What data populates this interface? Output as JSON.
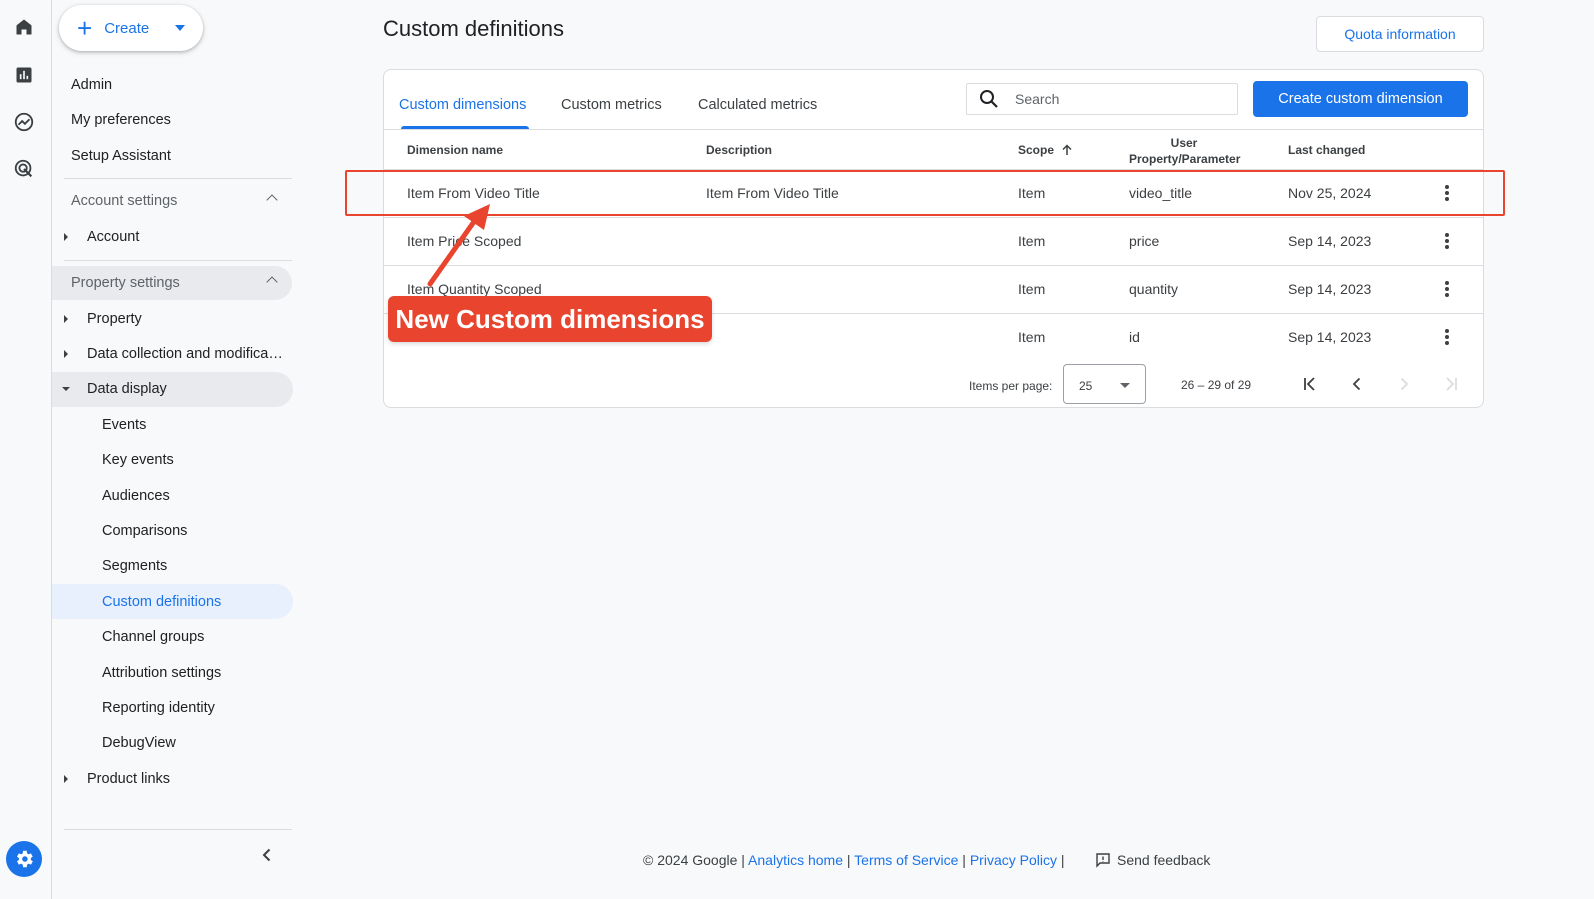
{
  "sidebar": {
    "create_label": "Create",
    "top_items": [
      "Admin",
      "My preferences",
      "Setup Assistant"
    ],
    "account_settings": {
      "header": "Account settings",
      "items": [
        "Account"
      ]
    },
    "property_settings": {
      "header": "Property settings",
      "items": [
        "Property",
        "Data collection and modifica…",
        "Data display"
      ],
      "data_display_children": [
        "Events",
        "Key events",
        "Audiences",
        "Comparisons",
        "Segments",
        "Custom definitions",
        "Channel groups",
        "Attribution settings",
        "Reporting identity",
        "DebugView"
      ],
      "product_links": "Product links"
    }
  },
  "main": {
    "title": "Custom definitions",
    "quota_button": "Quota information",
    "tabs": [
      "Custom dimensions",
      "Custom metrics",
      "Calculated metrics"
    ],
    "search_placeholder": "Search",
    "create_button": "Create custom dimension",
    "columns": {
      "name": "Dimension name",
      "description": "Description",
      "scope": "Scope",
      "user_property": "User Property/Parameter",
      "last_changed": "Last changed"
    },
    "rows": [
      {
        "name": "Item From Video Title",
        "description": "Item From Video Title",
        "scope": "Item",
        "param": "video_title",
        "date": "Nov 25, 2024"
      },
      {
        "name": "Item Price Scoped",
        "description": "",
        "scope": "Item",
        "param": "price",
        "date": "Sep 14, 2023"
      },
      {
        "name": "Item Quantity Scoped",
        "description": "",
        "scope": "Item",
        "param": "quantity",
        "date": "Sep 14, 2023"
      },
      {
        "name": "",
        "description": "",
        "scope": "Item",
        "param": "id",
        "date": "Sep 14, 2023"
      }
    ],
    "pager": {
      "label": "Items per page:",
      "per_page": "25",
      "range": "26 – 29 of 29"
    }
  },
  "annotation": {
    "callout": "New Custom dimensions",
    "color": "#e8442e"
  },
  "footer": {
    "copyright": "© 2024 Google",
    "links": [
      "Analytics home",
      "Terms of Service",
      "Privacy Policy"
    ],
    "feedback": "Send feedback"
  },
  "colors": {
    "accent": "#1a73e8",
    "selected_bg": "#e8f0fe",
    "hover_bg": "#e8eaed"
  }
}
